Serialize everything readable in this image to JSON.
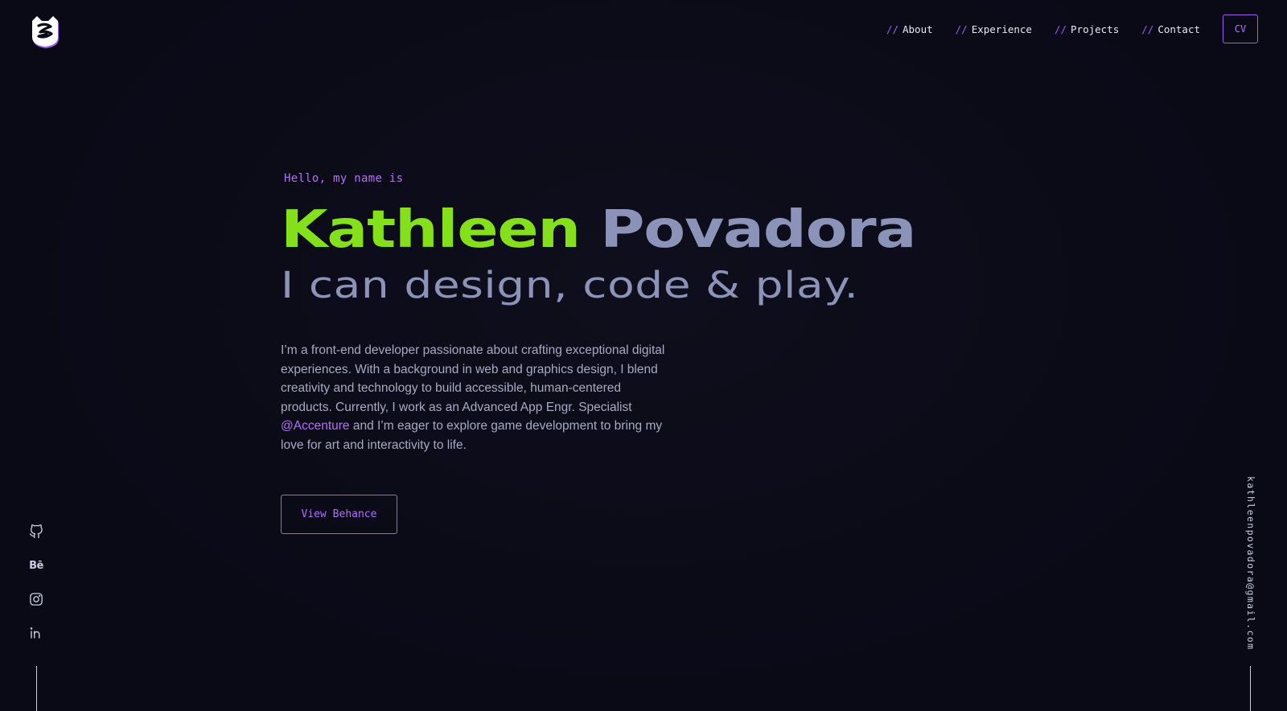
{
  "header": {
    "logo_label": "Kathleen Povadora logo",
    "nav": [
      {
        "prefix": "//",
        "label": "About"
      },
      {
        "prefix": "//",
        "label": "Experience"
      },
      {
        "prefix": "//",
        "label": "Projects"
      },
      {
        "prefix": "//",
        "label": "Contact"
      }
    ],
    "cv_label": "CV"
  },
  "hero": {
    "greeting": "Hello, my name is",
    "first_name": "Kathleen",
    "last_name": "Povadora",
    "tagline": "I can design, code & play.",
    "bio_part1": "I’m a front-end developer passionate about crafting exceptional digital experiences. With a background in web and graphics design, I blend creativity and technology to build accessible, human-centered products. Currently, I work as an Advanced App Engr. Specialist ",
    "bio_link": "@Accenture",
    "bio_part2": " and I’m eager to explore game development to bring my love for art and interactivity to life.",
    "cta_label": "View Behance"
  },
  "socials": [
    {
      "icon": "github-icon"
    },
    {
      "icon": "behance-icon",
      "text": "Bē"
    },
    {
      "icon": "instagram-icon"
    },
    {
      "icon": "linkedin-icon"
    }
  ],
  "email": "kathleenpovadora@gmail.com",
  "colors": {
    "background": "#0a0a17",
    "accent_purple": "#a45cf0",
    "accent_green": "#84e01a",
    "muted_slate": "#8b93b8"
  }
}
